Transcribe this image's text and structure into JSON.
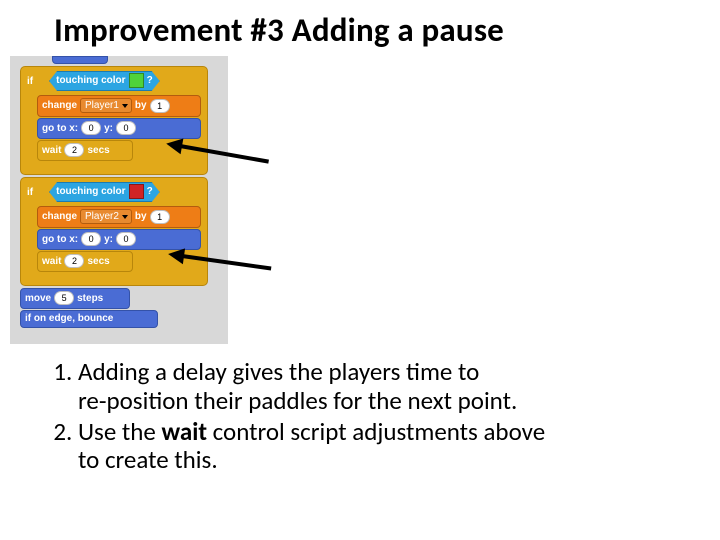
{
  "title": "Improvement #3 Adding a pause",
  "script": {
    "if1": {
      "label_if": "if",
      "touching": {
        "label": "touching color",
        "q": "?",
        "color": "#4fd23a"
      },
      "change": {
        "label_change": "change",
        "var": "Player1",
        "label_by": "by",
        "by": "1"
      },
      "goto": {
        "label_go": "go to x:",
        "x": "0",
        "label_y": "y:",
        "y": "0"
      },
      "wait": {
        "label_wait": "wait",
        "secs": "2",
        "label_secs": "secs"
      }
    },
    "if2": {
      "label_if": "if",
      "touching": {
        "label": "touching color",
        "q": "?",
        "color": "#d12424"
      },
      "change": {
        "label_change": "change",
        "var": "Player2",
        "label_by": "by",
        "by": "1"
      },
      "goto": {
        "label_go": "go to x:",
        "x": "0",
        "label_y": "y:",
        "y": "0"
      },
      "wait": {
        "label_wait": "wait",
        "secs": "2",
        "label_secs": "secs"
      }
    },
    "move": {
      "label_move": "move",
      "steps": "5",
      "label_steps": "steps"
    },
    "bounce": {
      "label": "if on edge, bounce"
    }
  },
  "list": {
    "item1a": "Adding a delay gives the players time to",
    "item1b": "re-position their paddles for the next point.",
    "item2a": "Use the ",
    "item2bold": "wait",
    "item2b": " control script adjustments above",
    "item2c": "to create this."
  }
}
